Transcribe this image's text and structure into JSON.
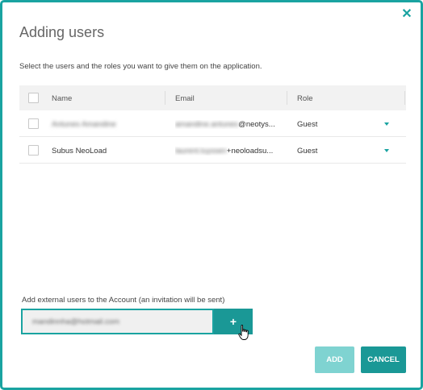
{
  "dialog": {
    "title": "Adding users",
    "subtitle": "Select the users and the roles you want to give them on the application.",
    "close_icon": "close-icon"
  },
  "table": {
    "headers": {
      "name": "Name",
      "email": "Email",
      "role": "Role"
    },
    "rows": [
      {
        "name": "Antunes Amandine",
        "email_blurred": "amandine.antunes",
        "email_domain": "@neotys...",
        "role": "Guest",
        "name_blurred": true
      },
      {
        "name": "Subus NeoLoad",
        "email_blurred": "laurent.luyssen",
        "email_domain": "+neoloadsu...",
        "role": "Guest",
        "name_blurred": false
      }
    ]
  },
  "external": {
    "label": "Add external users to the Account (an invitation will be sent)",
    "input_value": "mandinnha@hotmail.com",
    "add_symbol": "+"
  },
  "buttons": {
    "add": "ADD",
    "cancel": "CANCEL"
  },
  "colors": {
    "accent": "#1a9896",
    "accent_disabled": "#7fd3d1",
    "border": "#1aa3a1"
  }
}
